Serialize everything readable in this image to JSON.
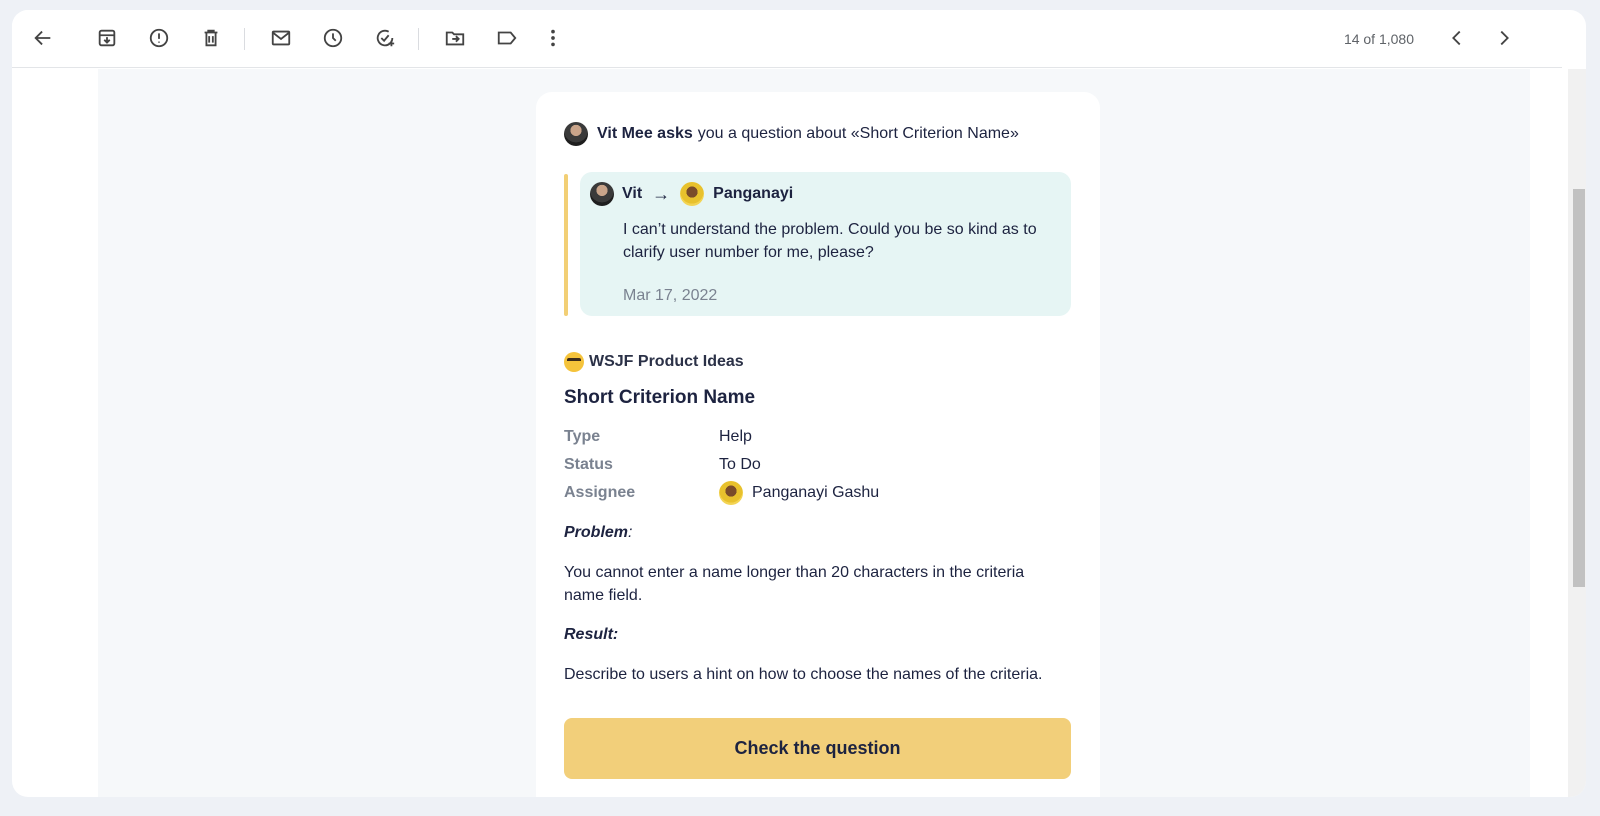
{
  "toolbar": {
    "icons": [
      "back-arrow-icon",
      "archive-icon",
      "report-spam-icon",
      "delete-icon",
      "mark-unread-icon",
      "snooze-icon",
      "add-task-icon",
      "move-to-icon",
      "label-icon",
      "more-vert-icon"
    ],
    "counter": "14 of 1,080",
    "prev_icon": "chevron-left-icon",
    "next_icon": "chevron-right-icon"
  },
  "email": {
    "ask": {
      "actor": "Vit Mee asks",
      "rest": "you a question about «Short Criterion Name»"
    },
    "quote": {
      "from": "Vit",
      "arrow": "→",
      "to": "Panganayi",
      "text": "I can’t understand the problem. Could you be so kind as to clarify user number for me, please?",
      "date": "Mar 17, 2022",
      "accent_color": "#f2cf75",
      "background": "#e6f5f4"
    },
    "project": "WSJF Product Ideas",
    "title": "Short Criterion Name",
    "props": [
      {
        "key": "Type",
        "value": "Help"
      },
      {
        "key": "Status",
        "value": "To Do"
      },
      {
        "key": "Assignee",
        "value": "Panganayi Gashu"
      }
    ],
    "problem_label": "Problem",
    "problem_colon": ":",
    "problem_text": "You cannot enter a name longer than 20 characters in the criteria name field.",
    "result_label": "Result:",
    "result_text": "Describe to users a hint on how to choose the names of the criteria.",
    "cta": "Check the question",
    "cta_color": "#f2cf7a"
  }
}
